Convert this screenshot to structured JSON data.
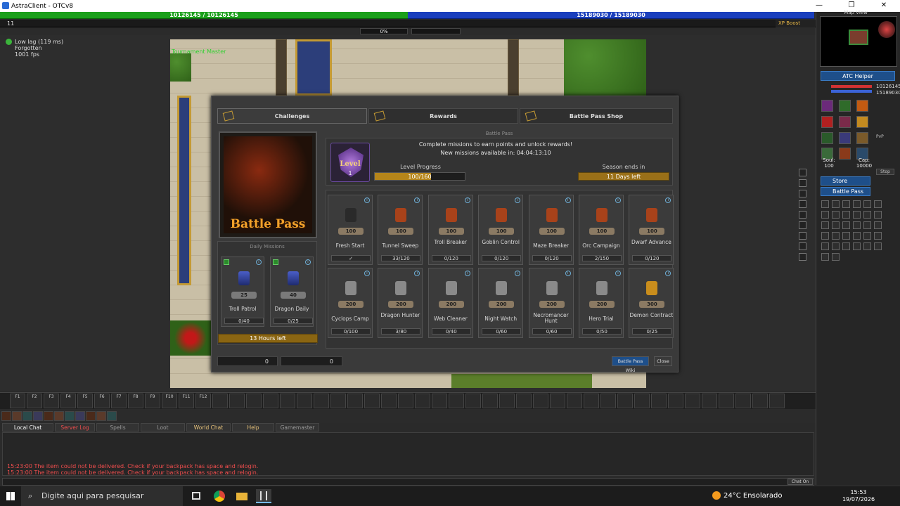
{
  "window": {
    "title": "AstraClient - OTCv8",
    "minimize": "—",
    "restore": "❐",
    "close": "✕"
  },
  "status_bars": {
    "health": "10126145 / 10126145",
    "mana": "15189030 / 15189030",
    "level": "11",
    "xp_percent": "0%",
    "xp_boost": "XP Boost"
  },
  "stats": {
    "lag": "Low lag (119 ms)",
    "world": "Forgotten",
    "fps": "1001 fps"
  },
  "player_name": "Tournament Master",
  "tabs": [
    {
      "label": "Challenges"
    },
    {
      "label": "Rewards"
    },
    {
      "label": "Battle Pass Shop"
    }
  ],
  "battle_pass": {
    "image_text": "Battle Pass",
    "title": "Battle Pass",
    "description": "Complete missions to earn points and unlock rewards!",
    "new_missions": "New missions available in: 04:04:13:10",
    "level_label": "Level",
    "level_value": "1",
    "level_progress_label": "Level Progress",
    "level_progress_value": "100/160",
    "level_progress_fraction": 0.625,
    "season_label": "Season ends in",
    "season_value": "11 Days left"
  },
  "daily_missions": {
    "title": "Daily Missions",
    "items": [
      {
        "name": "Troll Patrol",
        "points": "25",
        "progress": "0/40"
      },
      {
        "name": "Dragon Daily",
        "points": "40",
        "progress": "0/25"
      }
    ],
    "timer": "13 Hours left"
  },
  "missions": [
    {
      "name": "Fresh Start",
      "points": "100",
      "progress": "✓",
      "icon": "check-icon"
    },
    {
      "name": "Tunnel Sweep",
      "points": "100",
      "progress": "33/120",
      "icon": "orange-star-icon"
    },
    {
      "name": "Troll Breaker",
      "points": "100",
      "progress": "0/120",
      "icon": "orange-star-icon"
    },
    {
      "name": "Goblin Control",
      "points": "100",
      "progress": "0/120",
      "icon": "orange-star-icon"
    },
    {
      "name": "Maze Breaker",
      "points": "100",
      "progress": "0/120",
      "icon": "orange-star-icon"
    },
    {
      "name": "Orc Campaign",
      "points": "100",
      "progress": "2/150",
      "icon": "orange-star-icon"
    },
    {
      "name": "Dwarf Advance",
      "points": "100",
      "progress": "0/120",
      "icon": "orange-star-icon"
    },
    {
      "name": "Cyclops Camp",
      "points": "200",
      "progress": "0/100",
      "icon": "silver-exclamation-icon"
    },
    {
      "name": "Dragon Hunter",
      "points": "200",
      "progress": "3/80",
      "icon": "silver-exclamation-icon"
    },
    {
      "name": "Web Cleaner",
      "points": "200",
      "progress": "0/40",
      "icon": "silver-exclamation-icon"
    },
    {
      "name": "Night Watch",
      "points": "200",
      "progress": "0/60",
      "icon": "silver-exclamation-icon"
    },
    {
      "name": "Necromancer Hunt",
      "points": "200",
      "progress": "0/60",
      "icon": "silver-exclamation-icon"
    },
    {
      "name": "Hero Trial",
      "points": "200",
      "progress": "0/50",
      "icon": "silver-exclamation-icon"
    },
    {
      "name": "Demon Contract",
      "points": "300",
      "progress": "0/25",
      "icon": "gold-exclamation-icon"
    }
  ],
  "footer": {
    "currency1": "0",
    "currency2": "0",
    "wiki_button": "Battle Pass Wiki",
    "close_button": "Close"
  },
  "sidebar": {
    "map_view": "Map View",
    "atc_helper": "ATC Helper",
    "hp": "10126145",
    "mp": "15189030",
    "soul_label": "Soul:",
    "soul": "100",
    "cap_label": "Cap:",
    "cap": "10000",
    "stop": "Stop",
    "pvp": "PvP",
    "store": "Store",
    "battle_pass": "Battle Pass"
  },
  "hotkeys": [
    "F1",
    "F2",
    "F3",
    "F4",
    "F5",
    "F6",
    "F7",
    "F8",
    "F9",
    "F10",
    "F11",
    "F12"
  ],
  "chat": {
    "tabs": [
      "Local Chat",
      "Server Log",
      "Spells",
      "Loot",
      "World Chat",
      "Help",
      "Gamemaster"
    ],
    "lines": [
      "15:23:00 The item could not be delivered. Check if your backpack has space and relogin.",
      "15:23:00 The item could not be delivered. Check if your backpack has space and relogin."
    ],
    "chat_on": "Chat On"
  },
  "taskbar": {
    "search": "Digite aqui para pesquisar",
    "weather": "24°C  Ensolarado",
    "time": "15:53",
    "date": "19/07/2026"
  },
  "colors": {
    "health": "#1b9f1b",
    "mana": "#1a3fbd",
    "accent_gold": "#b5851a",
    "chat_error": "#f04d4d"
  }
}
